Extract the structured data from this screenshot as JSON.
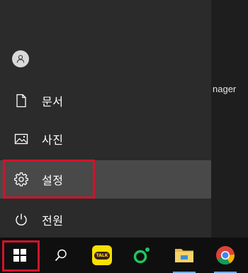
{
  "background_window": {
    "text": "nager"
  },
  "start_menu": {
    "avatar_icon": "user-icon",
    "items": [
      {
        "label": "문서",
        "icon": "document-icon"
      },
      {
        "label": "사진",
        "icon": "pictures-icon"
      },
      {
        "label": "설정",
        "icon": "settings-gear-icon"
      },
      {
        "label": "전원",
        "icon": "power-icon"
      }
    ]
  },
  "taskbar": {
    "buttons": [
      {
        "name": "start",
        "icon": "windows-logo-icon"
      },
      {
        "name": "search",
        "icon": "search-icon"
      },
      {
        "name": "kakaotalk",
        "icon": "kakaotalk-icon",
        "badge_text": "TALK"
      },
      {
        "name": "green-app",
        "icon": "green-app-icon"
      },
      {
        "name": "file-explorer",
        "icon": "folder-icon"
      },
      {
        "name": "chrome",
        "icon": "chrome-icon"
      }
    ]
  },
  "colors": {
    "menu_bg": "#2b2b2b",
    "menu_active": "#494949",
    "taskbar_bg": "#0f0f0f",
    "highlight": "#d0142c",
    "kakao_yellow": "#f9e000"
  }
}
